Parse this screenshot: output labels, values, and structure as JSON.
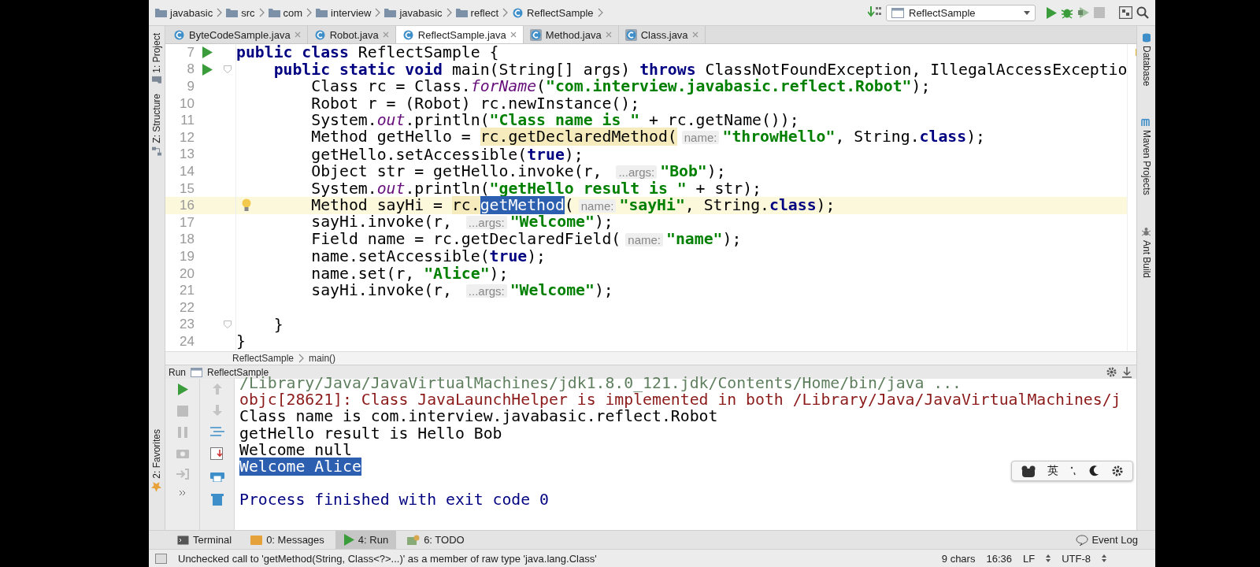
{
  "breadcrumbs": [
    {
      "label": "javabasic",
      "kind": "folder"
    },
    {
      "label": "src",
      "kind": "folder"
    },
    {
      "label": "com",
      "kind": "folder"
    },
    {
      "label": "interview",
      "kind": "folder"
    },
    {
      "label": "javabasic",
      "kind": "folder"
    },
    {
      "label": "reflect",
      "kind": "folder"
    },
    {
      "label": "ReflectSample",
      "kind": "class"
    }
  ],
  "run_config": {
    "value": "ReflectSample"
  },
  "editor_tabs": [
    {
      "label": "ByteCodeSample.java",
      "kind": "class",
      "selected": false
    },
    {
      "label": "Robot.java",
      "kind": "class",
      "selected": false
    },
    {
      "label": "ReflectSample.java",
      "kind": "class",
      "selected": true
    },
    {
      "label": "Method.java",
      "kind": "compiled",
      "selected": false
    },
    {
      "label": "Class.java",
      "kind": "compiled",
      "selected": false
    }
  ],
  "left_tool_windows": [
    {
      "label": "1: Project",
      "kind": "project"
    },
    {
      "label": "Z: Structure",
      "kind": "structure"
    },
    {
      "label": "2: Favorites",
      "kind": "favorites"
    }
  ],
  "right_tool_windows": [
    {
      "label": "Database",
      "kind": "database"
    },
    {
      "label": "Maven Projects",
      "kind": "maven"
    },
    {
      "label": "Ant Build",
      "kind": "ant"
    }
  ],
  "editor": {
    "lines": [
      {
        "number": "7",
        "run_marker": true,
        "tokens": [
          {
            "kind": "keyword",
            "text": "public class"
          },
          {
            "kind": "plain",
            "text": " ReflectSample {"
          }
        ]
      },
      {
        "number": "8",
        "run_marker": true,
        "fold": true,
        "tokens": [
          {
            "kind": "keyword",
            "text": "    public static void"
          },
          {
            "kind": "plain",
            "text": " main(String[] args) "
          },
          {
            "kind": "keyword",
            "text": "throws"
          },
          {
            "kind": "plain",
            "text": " ClassNotFoundException, IllegalAccessExceptio"
          }
        ]
      },
      {
        "number": "9",
        "tokens": [
          {
            "kind": "plain",
            "text": "        Class rc = Class."
          },
          {
            "kind": "italic",
            "text": "forName"
          },
          {
            "kind": "plain",
            "text": "("
          },
          {
            "kind": "string",
            "text": "\"com.interview.javabasic.reflect.Robot\""
          },
          {
            "kind": "plain",
            "text": ");"
          }
        ]
      },
      {
        "number": "10",
        "tokens": [
          {
            "kind": "plain",
            "text": "        Robot r = (Robot) rc.newInstance();"
          }
        ]
      },
      {
        "number": "11",
        "tokens": [
          {
            "kind": "plain",
            "text": "        System."
          },
          {
            "kind": "italic",
            "text": "out"
          },
          {
            "kind": "plain",
            "text": ".println("
          },
          {
            "kind": "string",
            "text": "\"Class name is \""
          },
          {
            "kind": "plain",
            "text": " + rc.getName());"
          }
        ]
      },
      {
        "number": "12",
        "tokens": [
          {
            "kind": "plain",
            "text": "        Method getHello = "
          },
          {
            "kind": "warning",
            "text": "rc.getDeclaredMethod("
          },
          {
            "kind": "hint",
            "text": "name:"
          },
          {
            "kind": "string",
            "text": "\"throwHello\""
          },
          {
            "kind": "plain",
            "text": ", String."
          },
          {
            "kind": "keyword",
            "text": "class"
          },
          {
            "kind": "plain",
            "text": ");"
          }
        ]
      },
      {
        "number": "13",
        "tokens": [
          {
            "kind": "plain",
            "text": "        getHello.setAccessible("
          },
          {
            "kind": "keyword",
            "text": "true"
          },
          {
            "kind": "plain",
            "text": ");"
          }
        ]
      },
      {
        "number": "14",
        "tokens": [
          {
            "kind": "plain",
            "text": "        Object str = getHello.invoke(r, "
          },
          {
            "kind": "hint",
            "text": "...args:"
          },
          {
            "kind": "string",
            "text": "\"Bob\""
          },
          {
            "kind": "plain",
            "text": ");"
          }
        ]
      },
      {
        "number": "15",
        "tokens": [
          {
            "kind": "plain",
            "text": "        System."
          },
          {
            "kind": "italic",
            "text": "out"
          },
          {
            "kind": "plain",
            "text": ".println("
          },
          {
            "kind": "string",
            "text": "\"getHello result is \""
          },
          {
            "kind": "plain",
            "text": " + str);"
          }
        ]
      },
      {
        "number": "16",
        "current": true,
        "bulb": true,
        "tokens": [
          {
            "kind": "plain",
            "text": "        Method sayHi = "
          },
          {
            "kind": "warning",
            "text": "rc."
          },
          {
            "kind": "selected",
            "text": "getMethod"
          },
          {
            "kind": "plain",
            "text": "("
          },
          {
            "kind": "hint",
            "text": "name:"
          },
          {
            "kind": "string",
            "text": "\"sayHi\""
          },
          {
            "kind": "plain",
            "text": ", String."
          },
          {
            "kind": "keyword",
            "text": "class"
          },
          {
            "kind": "plain",
            "text": ");"
          }
        ]
      },
      {
        "number": "17",
        "tokens": [
          {
            "kind": "plain",
            "text": "        sayHi.invoke(r, "
          },
          {
            "kind": "hint",
            "text": "...args:"
          },
          {
            "kind": "string",
            "text": "\"Welcome\""
          },
          {
            "kind": "plain",
            "text": ");"
          }
        ]
      },
      {
        "number": "18",
        "tokens": [
          {
            "kind": "plain",
            "text": "        Field name = rc.getDeclaredField("
          },
          {
            "kind": "hint",
            "text": "name:"
          },
          {
            "kind": "string",
            "text": "\"name\""
          },
          {
            "kind": "plain",
            "text": ");"
          }
        ]
      },
      {
        "number": "19",
        "tokens": [
          {
            "kind": "plain",
            "text": "        name.setAccessible("
          },
          {
            "kind": "keyword",
            "text": "true"
          },
          {
            "kind": "plain",
            "text": ");"
          }
        ]
      },
      {
        "number": "20",
        "tokens": [
          {
            "kind": "plain",
            "text": "        name.set(r, "
          },
          {
            "kind": "string",
            "text": "\"Alice\""
          },
          {
            "kind": "plain",
            "text": ");"
          }
        ]
      },
      {
        "number": "21",
        "tokens": [
          {
            "kind": "plain",
            "text": "        sayHi.invoke(r, "
          },
          {
            "kind": "hint",
            "text": "...args:"
          },
          {
            "kind": "string",
            "text": "\"Welcome\""
          },
          {
            "kind": "plain",
            "text": ");"
          }
        ]
      },
      {
        "number": "22"
      },
      {
        "number": "23",
        "fold": true,
        "tokens": [
          {
            "kind": "plain",
            "text": "    }"
          }
        ]
      },
      {
        "number": "24",
        "tokens": [
          {
            "kind": "plain",
            "text": "}"
          }
        ]
      }
    ]
  },
  "editor_breadcrumbs": [
    "ReflectSample",
    "main()"
  ],
  "run_panel": {
    "label": "Run",
    "config": "ReflectSample",
    "output": [
      {
        "kind": "command",
        "text": "/Library/Java/JavaVirtualMachines/jdk1.8.0_121.jdk/Contents/Home/bin/java ..."
      },
      {
        "kind": "error",
        "text": "objc[28621]: Class JavaLaunchHelper is implemented in both /Library/Java/JavaVirtualMachines/j"
      },
      {
        "kind": "normal",
        "text": "Class name is com.interview.javabasic.reflect.Robot"
      },
      {
        "kind": "normal",
        "text": "getHello result is Hello Bob"
      },
      {
        "kind": "normal",
        "text": "Welcome null"
      },
      {
        "kind": "selected",
        "text": "Welcome Alice"
      },
      {
        "kind": "blank"
      },
      {
        "kind": "system",
        "text": "Process finished with exit code 0"
      }
    ]
  },
  "ime_toolbar": {
    "mode": "英"
  },
  "bottom_tabs": [
    {
      "label": "Terminal",
      "kind": "terminal",
      "selected": false
    },
    {
      "label": "0: Messages",
      "kind": "messages",
      "selected": false
    },
    {
      "label": "4: Run",
      "kind": "run",
      "selected": true
    },
    {
      "label": "6: TODO",
      "kind": "todo",
      "selected": false
    }
  ],
  "event_log": "Event Log",
  "status_bar": {
    "message": "Unchecked call to 'getMethod(String, Class<?>...)' as a member of raw type 'java.lang.Class'",
    "selection": "9 chars",
    "position": "16:36",
    "line_separator": "LF",
    "encoding": "UTF-8"
  }
}
